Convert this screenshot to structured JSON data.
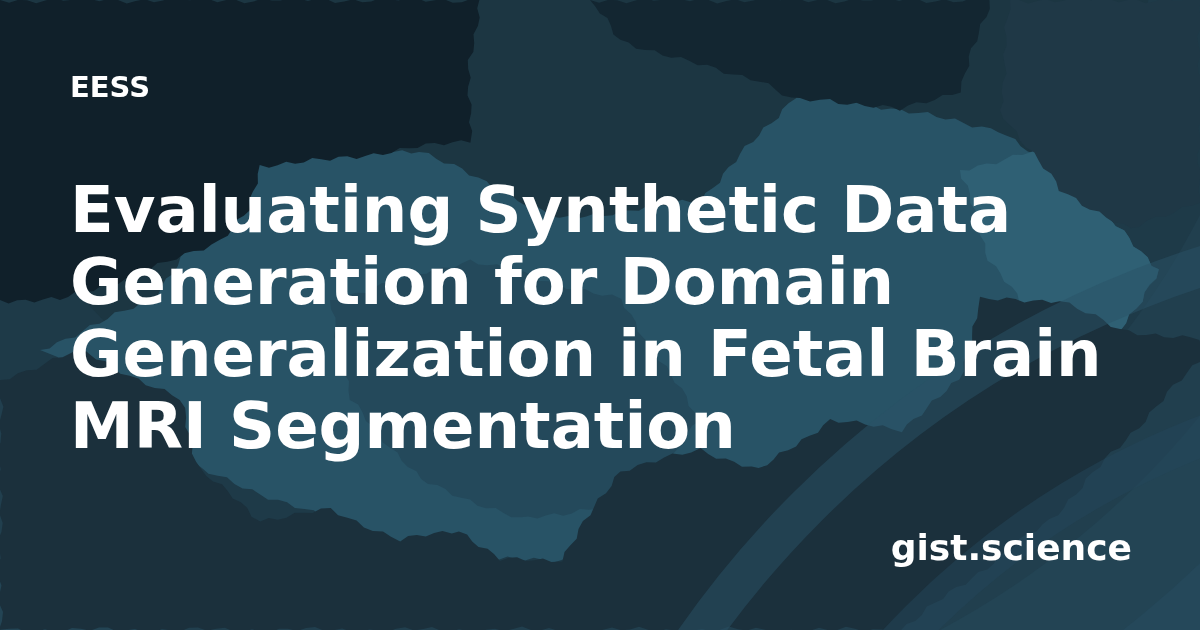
{
  "category": "EESS",
  "title": "Evaluating Synthetic Data Generation for Domain Generalization in Fetal Brain MRI Segmentation",
  "site": "gist.science"
}
